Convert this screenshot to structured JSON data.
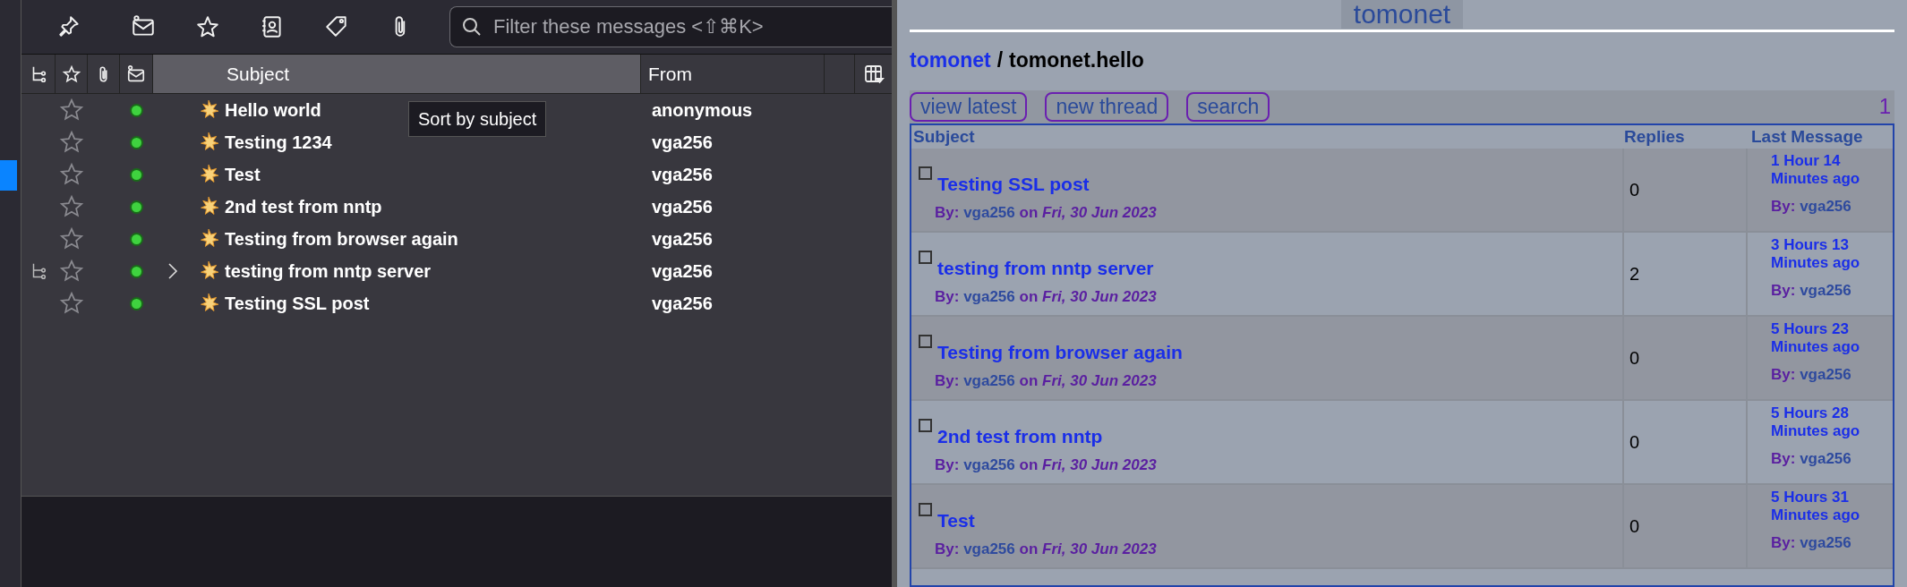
{
  "mail": {
    "search": {
      "placeholder": "Filter these messages <⇧⌘K>"
    },
    "columns": [
      {
        "label": "Subject",
        "hovered": true
      },
      {
        "label": "From",
        "hovered": false
      }
    ],
    "tooltip": "Sort by subject",
    "messages": [
      {
        "subject": "Hello world",
        "from": "anonymous",
        "starred": false,
        "unread": true,
        "thread": false
      },
      {
        "subject": "Testing 1234",
        "from": "vga256",
        "starred": false,
        "unread": true,
        "thread": false
      },
      {
        "subject": "Test",
        "from": "vga256",
        "starred": false,
        "unread": true,
        "thread": false
      },
      {
        "subject": "2nd test from nntp",
        "from": "vga256",
        "starred": false,
        "unread": true,
        "thread": false
      },
      {
        "subject": "Testing from browser again",
        "from": "vga256",
        "starred": false,
        "unread": true,
        "thread": false
      },
      {
        "subject": "testing from nntp server",
        "from": "vga256",
        "starred": false,
        "unread": true,
        "thread": true,
        "expanded": false
      },
      {
        "subject": "Testing SSL post",
        "from": "vga256",
        "starred": false,
        "unread": true,
        "thread": false
      }
    ]
  },
  "forum": {
    "site_title": "tomonet",
    "breadcrumb": {
      "link": "tomonet",
      "separator": "/",
      "current": "tomonet.hello"
    },
    "buttons": [
      "view latest",
      "new thread",
      "search"
    ],
    "page": "1",
    "columns": [
      "Subject",
      "Replies",
      "Last Message"
    ],
    "threads": [
      {
        "subject": "Testing SSL post",
        "by": "By:",
        "author": "vga256",
        "on": "on",
        "date": "Fri, 30 Jun 2023",
        "replies": "0",
        "last_time": "1 Hour 14 Minutes ago",
        "last_by": "By:",
        "last_author": "vga256"
      },
      {
        "subject": "testing from nntp server",
        "by": "By:",
        "author": "vga256",
        "on": "on",
        "date": "Fri, 30 Jun 2023",
        "replies": "2",
        "last_time": "3 Hours 13 Minutes ago",
        "last_by": "By:",
        "last_author": "vga256"
      },
      {
        "subject": "Testing from browser again",
        "by": "By:",
        "author": "vga256",
        "on": "on",
        "date": "Fri, 30 Jun 2023",
        "replies": "0",
        "last_time": "5 Hours 23 Minutes ago",
        "last_by": "By:",
        "last_author": "vga256"
      },
      {
        "subject": "2nd test from nntp",
        "by": "By:",
        "author": "vga256",
        "on": "on",
        "date": "Fri, 30 Jun 2023",
        "replies": "0",
        "last_time": "5 Hours 28 Minutes ago",
        "last_by": "By:",
        "last_author": "vga256"
      },
      {
        "subject": "Test",
        "by": "By:",
        "author": "vga256",
        "on": "on",
        "date": "Fri, 30 Jun 2023",
        "replies": "0",
        "last_time": "5 Hours 31 Minutes ago",
        "last_by": "By:",
        "last_author": "vga256"
      }
    ]
  }
}
